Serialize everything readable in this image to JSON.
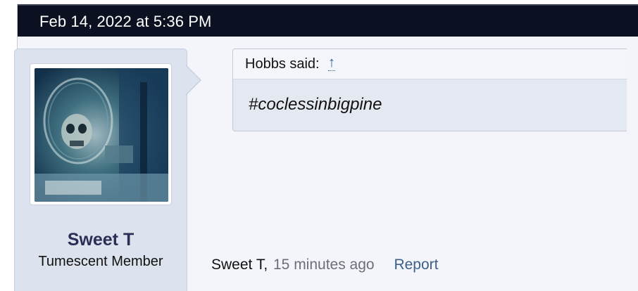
{
  "post": {
    "date": "Feb 14, 2022 at 5:36 PM",
    "user": {
      "name": "Sweet T",
      "title": "Tumescent Member",
      "avatar": "user-avatar-image"
    },
    "quote": {
      "author_label": "Hobbs said:",
      "jump_icon": "↑",
      "text": "#coclessinbigpine"
    },
    "meta": {
      "author": "Sweet T,",
      "time": "15 minutes ago",
      "report_label": "Report"
    }
  },
  "colors": {
    "header_bg": "#0b1120",
    "post_bg": "#f4f5fb",
    "userblock_bg": "#dde3ee",
    "username": "#2b2f55",
    "link": "#3c5f86"
  }
}
